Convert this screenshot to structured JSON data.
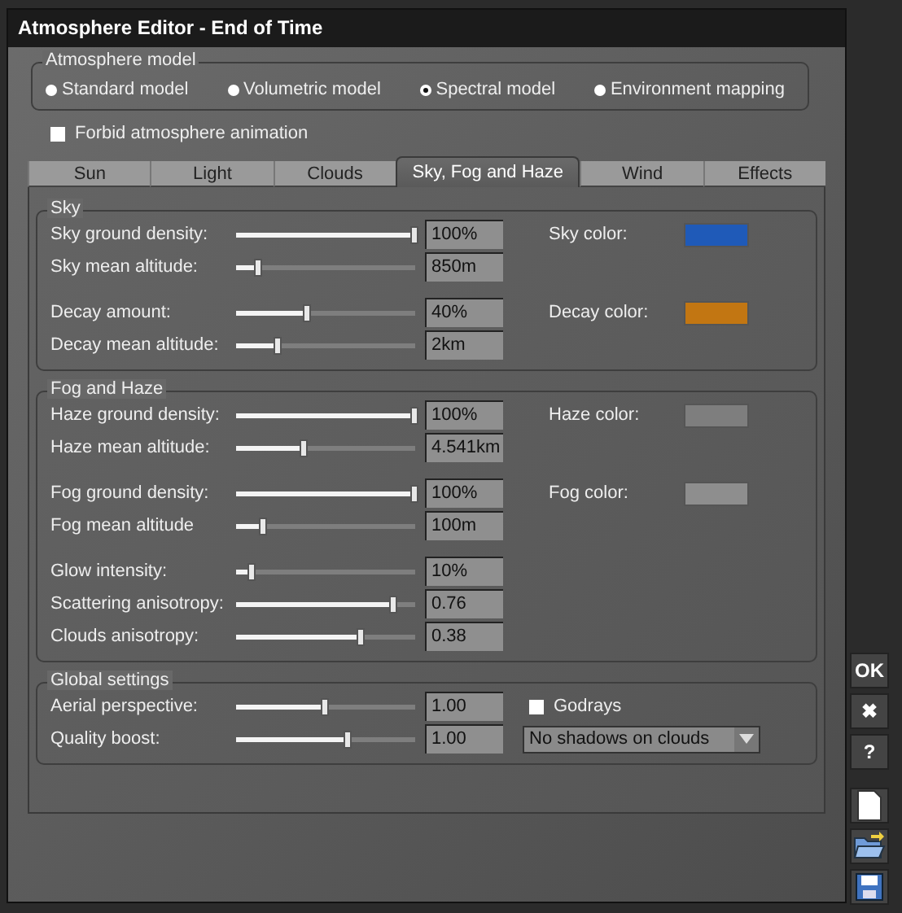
{
  "window": {
    "title": "Atmosphere Editor - End of Time"
  },
  "atmosphere_model": {
    "label": "Atmosphere model",
    "options": [
      {
        "label": "Standard model",
        "selected": false
      },
      {
        "label": "Volumetric model",
        "selected": false
      },
      {
        "label": "Spectral model",
        "selected": true
      },
      {
        "label": "Environment mapping",
        "selected": false
      }
    ]
  },
  "forbid_animation": {
    "label": "Forbid atmosphere animation",
    "checked": false
  },
  "tabs": [
    {
      "label": "Sun",
      "selected": false
    },
    {
      "label": "Light",
      "selected": false
    },
    {
      "label": "Clouds",
      "selected": false
    },
    {
      "label": "Sky, Fog and Haze",
      "selected": true
    },
    {
      "label": "Wind",
      "selected": false
    },
    {
      "label": "Effects",
      "selected": false
    }
  ],
  "sections": [
    {
      "title": "Sky",
      "groups": [
        [
          {
            "label": "Sky ground density:",
            "level": 1.0,
            "value": "100%",
            "swatch": {
              "label": "Sky color:",
              "color": "#1f5ab8"
            }
          },
          {
            "label": "Sky mean altitude:",
            "level": 0.13,
            "value": "850m"
          }
        ],
        [
          {
            "label": "Decay amount:",
            "level": 0.4,
            "value": "40%",
            "swatch": {
              "label": "Decay color:",
              "color": "#c27612"
            }
          },
          {
            "label": "Decay mean altitude:",
            "level": 0.24,
            "value": "2km"
          }
        ]
      ]
    },
    {
      "title": "Fog and Haze",
      "groups": [
        [
          {
            "label": "Haze ground density:",
            "level": 1.0,
            "value": "100%",
            "swatch": {
              "label": "Haze color:",
              "color": "#7e7e7e"
            }
          },
          {
            "label": "Haze mean altitude:",
            "level": 0.38,
            "value": "4.541km"
          }
        ],
        [
          {
            "label": "Fog ground density:",
            "level": 1.0,
            "value": "100%",
            "swatch": {
              "label": "Fog color:",
              "color": "#8e8e8e"
            }
          },
          {
            "label": "Fog mean altitude",
            "level": 0.15,
            "value": "100m"
          }
        ],
        [
          {
            "label": "Glow intensity:",
            "level": 0.09,
            "value": "10%"
          },
          {
            "label": "Scattering anisotropy:",
            "level": 0.88,
            "value": "0.76"
          },
          {
            "label": "Clouds anisotropy:",
            "level": 0.7,
            "value": "0.38"
          }
        ]
      ]
    },
    {
      "title": "Global settings",
      "groups": [
        [
          {
            "label": "Aerial perspective:",
            "level": 0.5,
            "value": "1.00",
            "extra": {
              "kind": "checkbox",
              "label": "Godrays",
              "checked": false
            }
          },
          {
            "label": "Quality boost:",
            "level": 0.63,
            "value": "1.00",
            "extra": {
              "kind": "dropdown",
              "value": "No shadows on clouds"
            }
          }
        ]
      ]
    }
  ],
  "side_buttons": [
    {
      "kind": "text",
      "label": "OK"
    },
    {
      "kind": "text",
      "label": "✖"
    },
    {
      "kind": "text",
      "label": "?"
    },
    {
      "kind": "new"
    },
    {
      "kind": "open"
    },
    {
      "kind": "save"
    }
  ]
}
